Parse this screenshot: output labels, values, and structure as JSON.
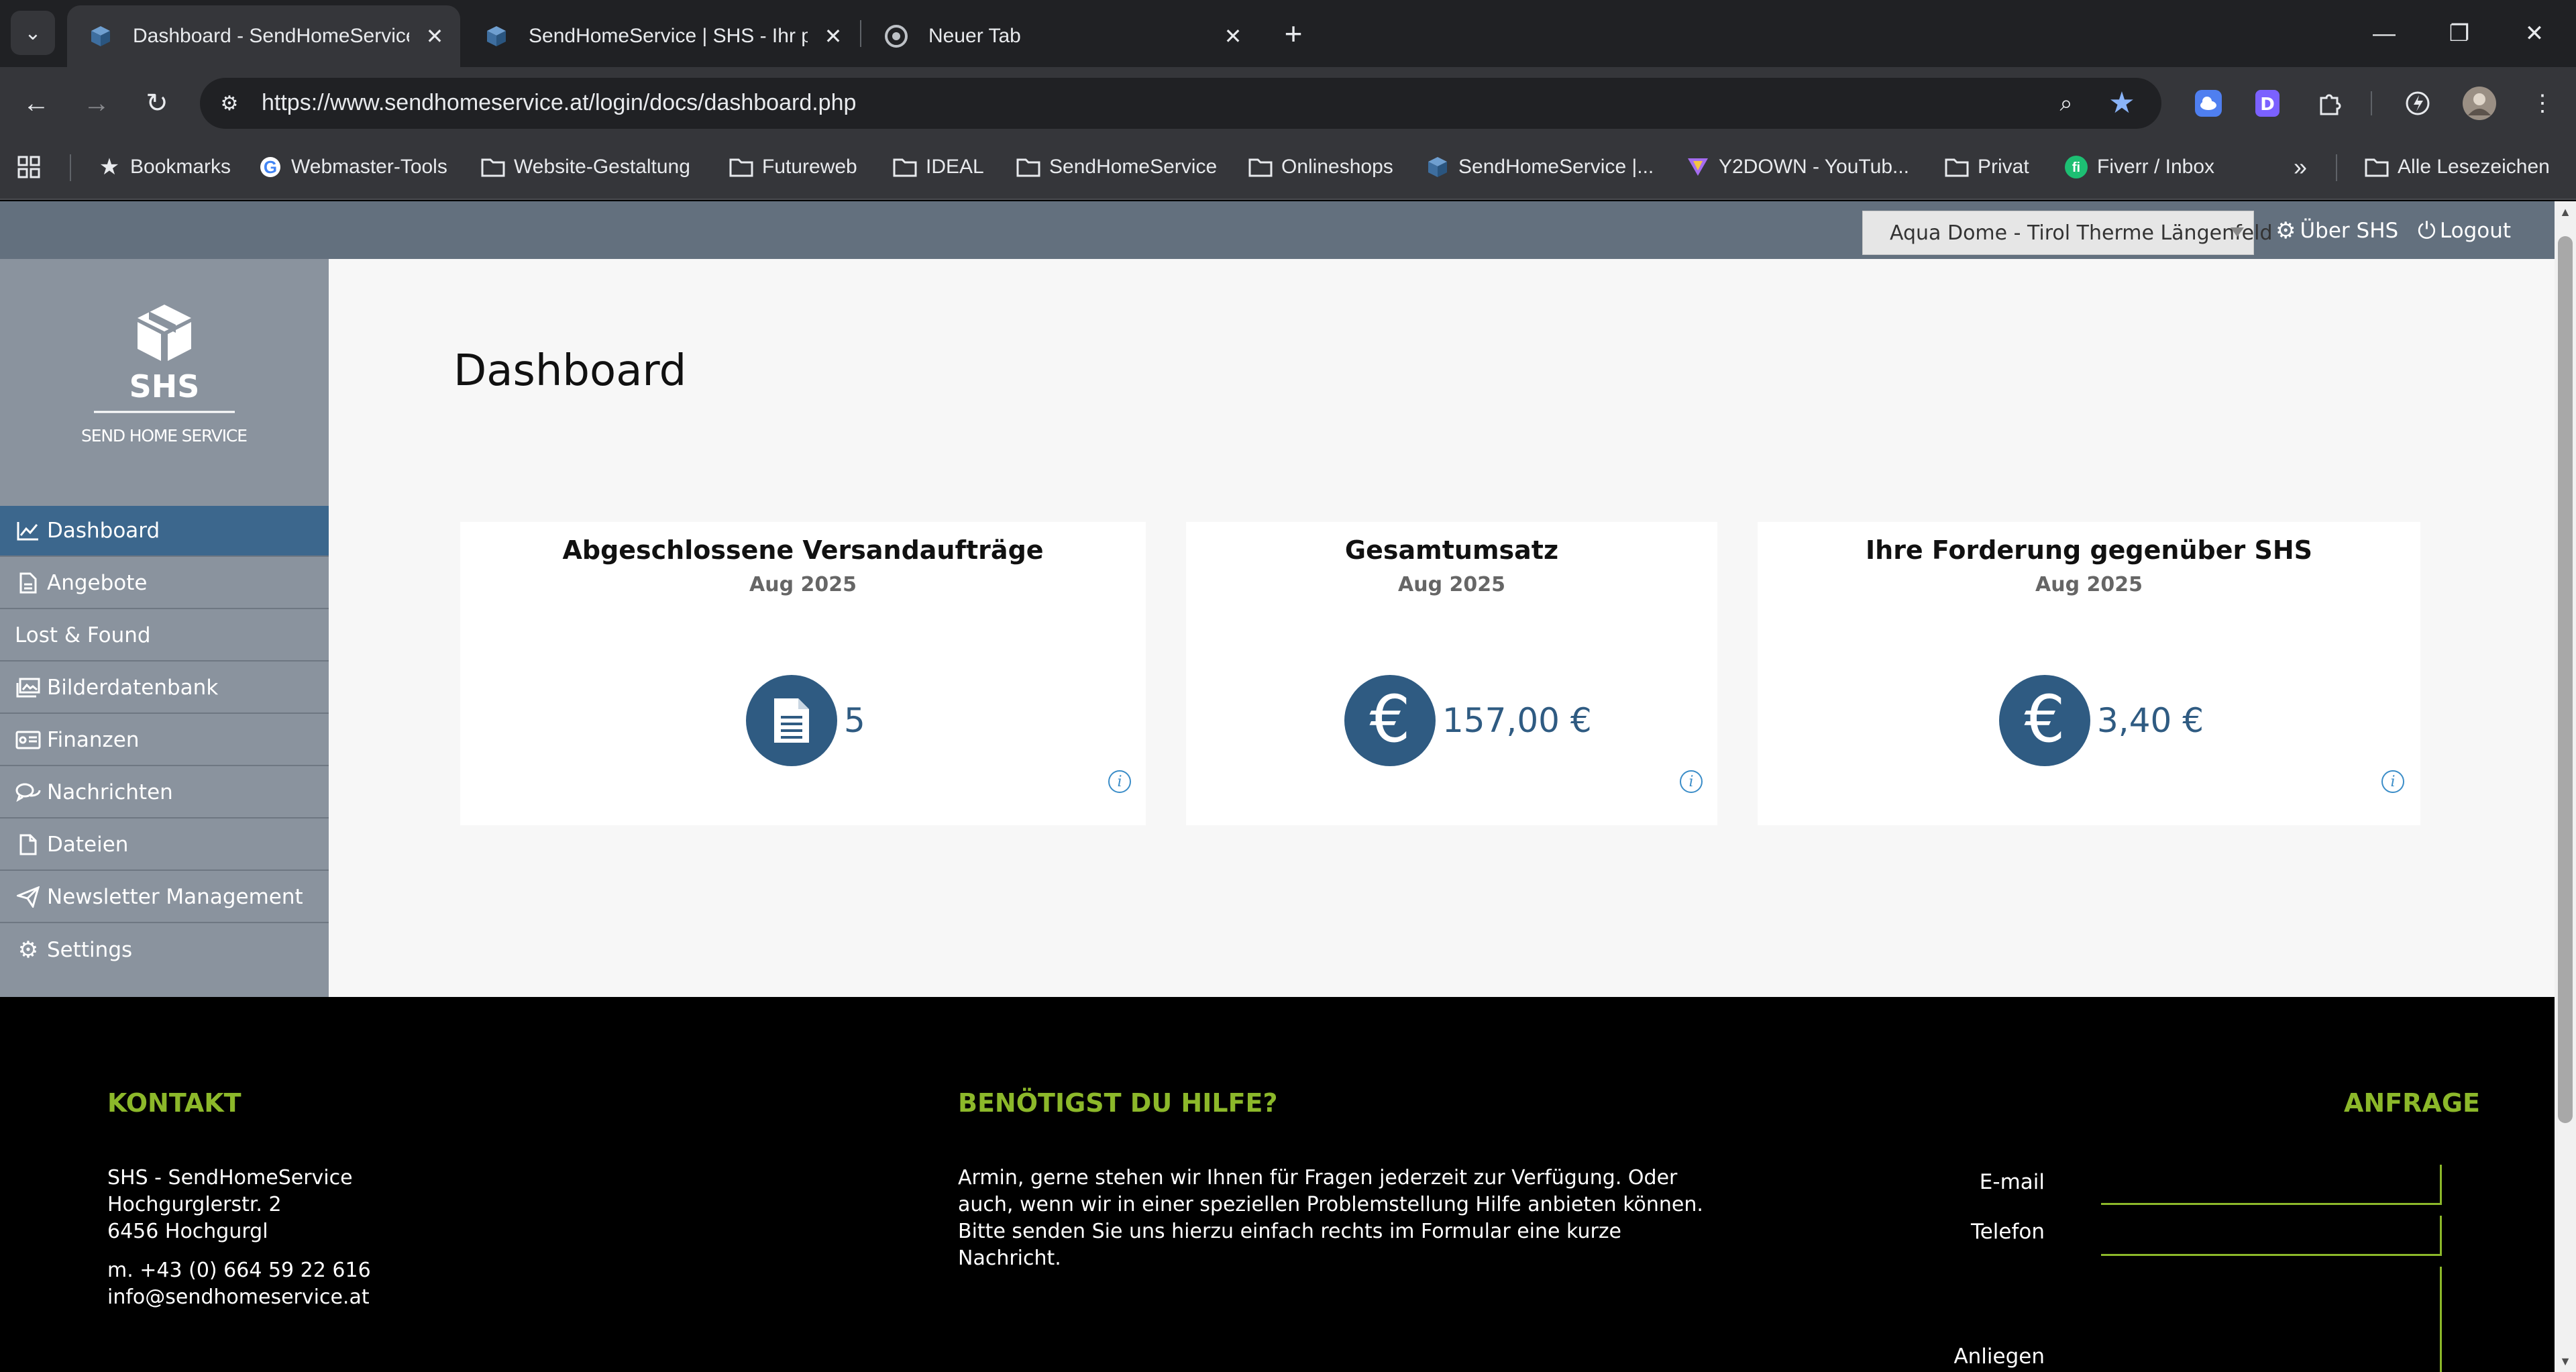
{
  "browser": {
    "tabs": [
      {
        "title": "Dashboard - SendHomeService",
        "active": true
      },
      {
        "title": "SendHomeService | SHS - Ihr pr",
        "active": false
      },
      {
        "title": "Neuer Tab",
        "active": false
      }
    ],
    "url": "https://www.sendhomeservice.at/login/docs/dashboard.php",
    "bookmarks": [
      {
        "label": "Bookmarks",
        "icon": "star-icon"
      },
      {
        "label": "Webmaster-Tools",
        "icon": "google-icon"
      },
      {
        "label": "Website-Gestaltung",
        "icon": "folder-icon"
      },
      {
        "label": "Futureweb",
        "icon": "folder-icon"
      },
      {
        "label": "IDEAL",
        "icon": "folder-icon"
      },
      {
        "label": "SendHomeService",
        "icon": "folder-icon"
      },
      {
        "label": "Onlineshops",
        "icon": "folder-icon"
      },
      {
        "label": "SendHomeService |...",
        "icon": "shs-favicon"
      },
      {
        "label": "Y2DOWN - YouTub...",
        "icon": "y2down-icon"
      },
      {
        "label": "Privat",
        "icon": "folder-icon"
      },
      {
        "label": "Fiverr / Inbox",
        "icon": "fiverr-icon"
      }
    ],
    "all_bookmarks": "Alle Lesezeichen"
  },
  "topbar": {
    "location": "Aqua Dome - Tirol Therme Längenfeld",
    "about": "Über SHS",
    "logout": "Logout"
  },
  "logo": {
    "short": "SHS",
    "full": "SEND HOME SERVICE"
  },
  "sidebar": {
    "items": [
      {
        "label": "Dashboard",
        "icon": "chart-line-icon",
        "active": true
      },
      {
        "label": "Angebote",
        "icon": "document-icon"
      },
      {
        "label": "Lost & Found",
        "icon": ""
      },
      {
        "label": "Bilderdatenbank",
        "icon": "images-icon"
      },
      {
        "label": "Finanzen",
        "icon": "money-card-icon"
      },
      {
        "label": "Nachrichten",
        "icon": "chat-icon"
      },
      {
        "label": "Dateien",
        "icon": "file-icon"
      },
      {
        "label": "Newsletter Management",
        "icon": "paper-plane-icon"
      },
      {
        "label": "Settings",
        "icon": "gear-icon"
      }
    ]
  },
  "main": {
    "title": "Dashboard",
    "cards": [
      {
        "title": "Abgeschlossene Versandaufträge",
        "period": "Aug 2025",
        "value": "5",
        "icon": "document-icon"
      },
      {
        "title": "Gesamtumsatz",
        "period": "Aug 2025",
        "value": "157,00 €",
        "icon": "euro-icon"
      },
      {
        "title": "Ihre Forderung gegenüber SHS",
        "period": "Aug 2025",
        "value": "3,40 €",
        "icon": "euro-icon"
      }
    ]
  },
  "footer": {
    "contact": {
      "heading": "KONTAKT",
      "lines": [
        "SHS - SendHomeService",
        "Hochgurglerstr. 2",
        "6456 Hochgurgl"
      ],
      "phone": "m. +43 (0) 664 59 22 616",
      "email": "info@sendhomeservice.at"
    },
    "help": {
      "heading": "BENÖTIGST DU HILFE?",
      "lines": [
        "Armin, gerne stehen wir Ihnen für Fragen jederzeit zur Verfügung. Oder",
        "auch, wenn wir in einer speziellen Problemstellung Hilfe anbieten können.",
        "Bitte senden Sie uns hierzu einfach rechts im Formular eine kurze",
        "Nachricht."
      ]
    },
    "request": {
      "heading": "ANFRAGE",
      "email_label": "E-mail",
      "phone_label": "Telefon",
      "concern_label": "Anliegen"
    }
  },
  "colors": {
    "brand_blue": "#2f5b82",
    "sidebar": "#8a939e",
    "topbar": "#63707e",
    "accent_green": "#8cb82a"
  }
}
